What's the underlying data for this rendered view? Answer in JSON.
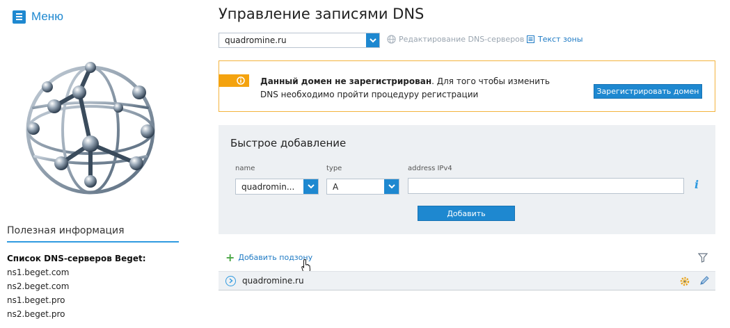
{
  "sidebar": {
    "menu_label": "Меню",
    "info_title": "Полезная информация",
    "dns_servers_title": "Список DNS-серверов Beget:",
    "dns_servers": [
      "ns1.beget.com",
      "ns2.beget.com",
      "ns1.beget.pro",
      "ns2.beget.pro"
    ]
  },
  "header": {
    "title": "Управление записями DNS",
    "domain_selected": "quadromine.ru",
    "edit_dns_servers_link": "Редактирование DNS-серверов",
    "zone_text_link": "Текст зоны"
  },
  "alert": {
    "bold_text": "Данный домен не зарегистрирован",
    "text": ". Для того чтобы изменить DNS необходимо пройти процедуру регистрации",
    "register_button": "Зарегистрировать домен"
  },
  "quick_add": {
    "title": "Быстрое добавление",
    "name_label": "name",
    "name_value": "quadromin...",
    "type_label": "type",
    "type_value": "A",
    "address_label": "address IPv4",
    "address_value": "",
    "add_button": "Добавить"
  },
  "records": {
    "add_subzone_link": "Добавить подзону",
    "zones": [
      {
        "name": "quadromine.ru"
      }
    ]
  },
  "colors": {
    "accent": "#1e88d0",
    "warning": "#f4a30f",
    "panel_bg": "#edf0f3",
    "plus_green": "#4aa644"
  },
  "icons": [
    "menu-icon",
    "chevron-down-icon",
    "globe-icon",
    "document-icon",
    "info-icon",
    "plus-icon",
    "filter-icon",
    "gear-icon",
    "pencil-icon",
    "expand-icon",
    "hand-cursor-icon"
  ]
}
